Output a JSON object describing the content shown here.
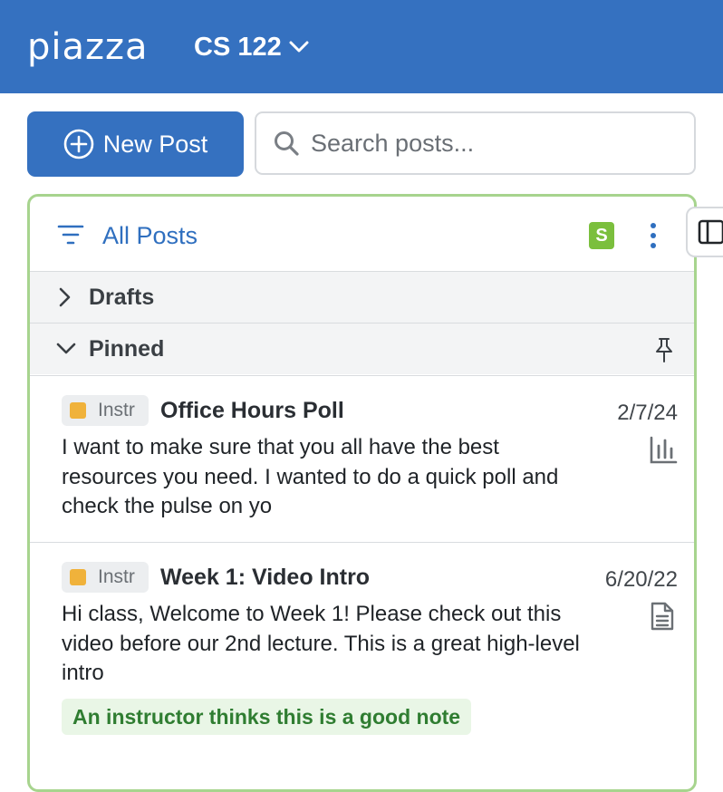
{
  "header": {
    "logo": "piazza",
    "course": "CS 122"
  },
  "toolbar": {
    "new_post_label": "New Post",
    "search_placeholder": "Search posts..."
  },
  "feed": {
    "filter_label": "All Posts",
    "status_badge": "S",
    "sections": [
      {
        "label": "Drafts",
        "expanded": false
      },
      {
        "label": "Pinned",
        "expanded": true
      }
    ]
  },
  "posts": [
    {
      "tag": "Instr",
      "title": "Office Hours Poll",
      "date": "2/7/24",
      "snippet": "I want to make sure that you all have the best resources you need. I wanted to do a quick poll and check the pulse on yo",
      "type_icon": "poll-icon"
    },
    {
      "tag": "Instr",
      "title": "Week 1: Video Intro",
      "date": "6/20/22",
      "snippet": "Hi class,  Welcome to Week 1! Please check out this video before our 2nd lecture. This is a great high-level intro",
      "type_icon": "note-icon",
      "endorsement": "An instructor thinks this is a good note"
    }
  ],
  "colors": {
    "brand": "#3571c0",
    "panel_border": "#a7d48e",
    "instr_tag": "#f0b23b",
    "good_note_text": "#2f7d31"
  }
}
